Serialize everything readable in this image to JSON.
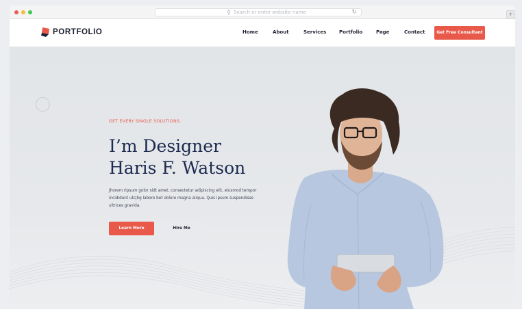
{
  "browser": {
    "url_placeholder": "Search or enter website name",
    "traffic_lights": [
      "#ee5e56",
      "#f5bd3c",
      "#3fc852"
    ]
  },
  "nav": {
    "brand": "PORTFOLIO",
    "items": [
      {
        "label": "Home"
      },
      {
        "label": "About"
      },
      {
        "label": "Services"
      },
      {
        "label": "Portfolio"
      },
      {
        "label": "Page"
      },
      {
        "label": "Contact"
      }
    ],
    "cta": "Get Free Consultant"
  },
  "hero": {
    "kicker": "GET EVERY SINGLE SOLUTIONS.",
    "title_line1": "I’m Designer",
    "title_line2": "Haris F. Watson",
    "paragraph": "Jhorem ripsum golor sidt amet, consectetur adipiscing elit, eiusmod tempor incididunt utcjhg labore bet dolore magna aliqua. Quis ipsum suspendisse ultrices gravida.",
    "primary_button": "Learn More",
    "secondary_button": "Hire Me"
  },
  "colors": {
    "accent": "#e8594a",
    "heading": "#1b2a4e",
    "hero_bg": "#e4e7ea"
  }
}
